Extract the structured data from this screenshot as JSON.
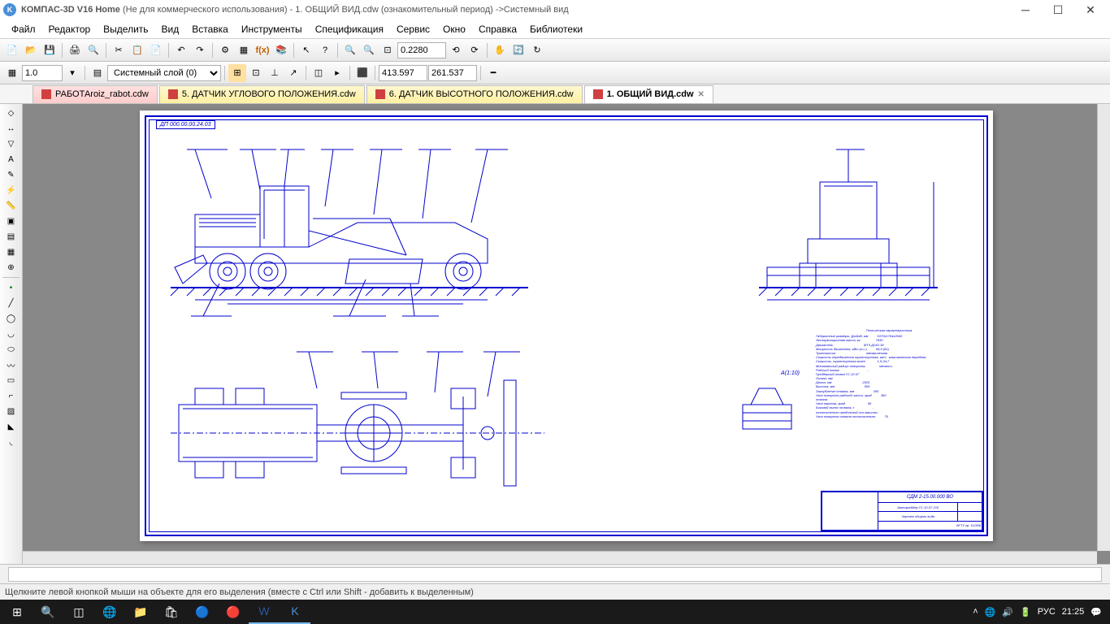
{
  "titlebar": {
    "app": "КОМПАС-3D V16 Home",
    "note": "(Не для коммерческого использования)",
    "doc": "- 1. ОБЩИЙ ВИД.cdw (ознакомительный период)",
    "view": "->Системный вид"
  },
  "menu": {
    "file": "Файл",
    "edit": "Редактор",
    "select": "Выделить",
    "view": "Вид",
    "insert": "Вставка",
    "tools": "Инструменты",
    "spec": "Спецификация",
    "service": "Сервис",
    "window": "Окно",
    "help": "Справка",
    "libs": "Библиотеки"
  },
  "toolbar2": {
    "scale": "1.0",
    "layer": "Системный слой (0)",
    "zoom": "0.2280",
    "coordX": "413.597",
    "coordY": "261.537"
  },
  "tabs": [
    {
      "label": "РАБОТАroiz_rabot.cdw",
      "style": "red"
    },
    {
      "label": "5. ДАТЧИК УГЛОВОГО ПОЛОЖЕНИЯ.cdw",
      "style": "yellow"
    },
    {
      "label": "6. ДАТЧИК ВЫСОТНОГО ПОЛОЖЕНИЯ.cdw",
      "style": "yellow"
    },
    {
      "label": "1. ОБЩИЙ ВИД.cdw",
      "style": "white"
    }
  ],
  "drawing": {
    "topcode": "ДП 000.00.00.24.03",
    "detail_label": "А(1:10)",
    "specs_title": "Техническая характеристика",
    "specs": [
      "Габаритные размеры, ДхШхВ, мм          6370х1764х2940",
      "Эксплуатационная масса, кг                 7930",
      "Двигатель                                  МТЗ Д243-18",
      "Мощность двигателя, кВт (л.с.)          59,6 (81)",
      "Трансмиссия                                  механическая",
      "Скорость передвижения транспортная, км/ч   максимальная передняя",
      "Скорость, транспортная мин/ч             1,9-34,7",
      "Минимальный радиус поворота,               механич.",
      "Рабочий отвал                               -",
      "Грейдерный отвал ГС-10.07",
      "",
      "Отвал, мм",
      "Длина, мм                                  2520",
      "Высота, мм                                 500",
      "Заглубление отвала, мм                     200",
      "Угол поворота рабочей части, град          360",
      "отвала",
      "Угол наклона, град                         90",
      "Боковой вынос отвала, с                    -",
      "относительно продольной оси машины",
      "Угол поворота отвала относительно          70"
    ],
    "title_block": {
      "code": "СДМ 2-15.00.000 ВО",
      "name1": "Автогрейдер ГС-10.07-210",
      "name2": "Чертеж общего вида",
      "org": "ВГТУ гр. 11СМ6"
    }
  },
  "status": "Щелкните левой кнопкой мыши на объекте для его выделения (вместе с Ctrl или Shift - добавить к выделенным)",
  "tray": {
    "lang": "РУС",
    "time": "21:25"
  }
}
